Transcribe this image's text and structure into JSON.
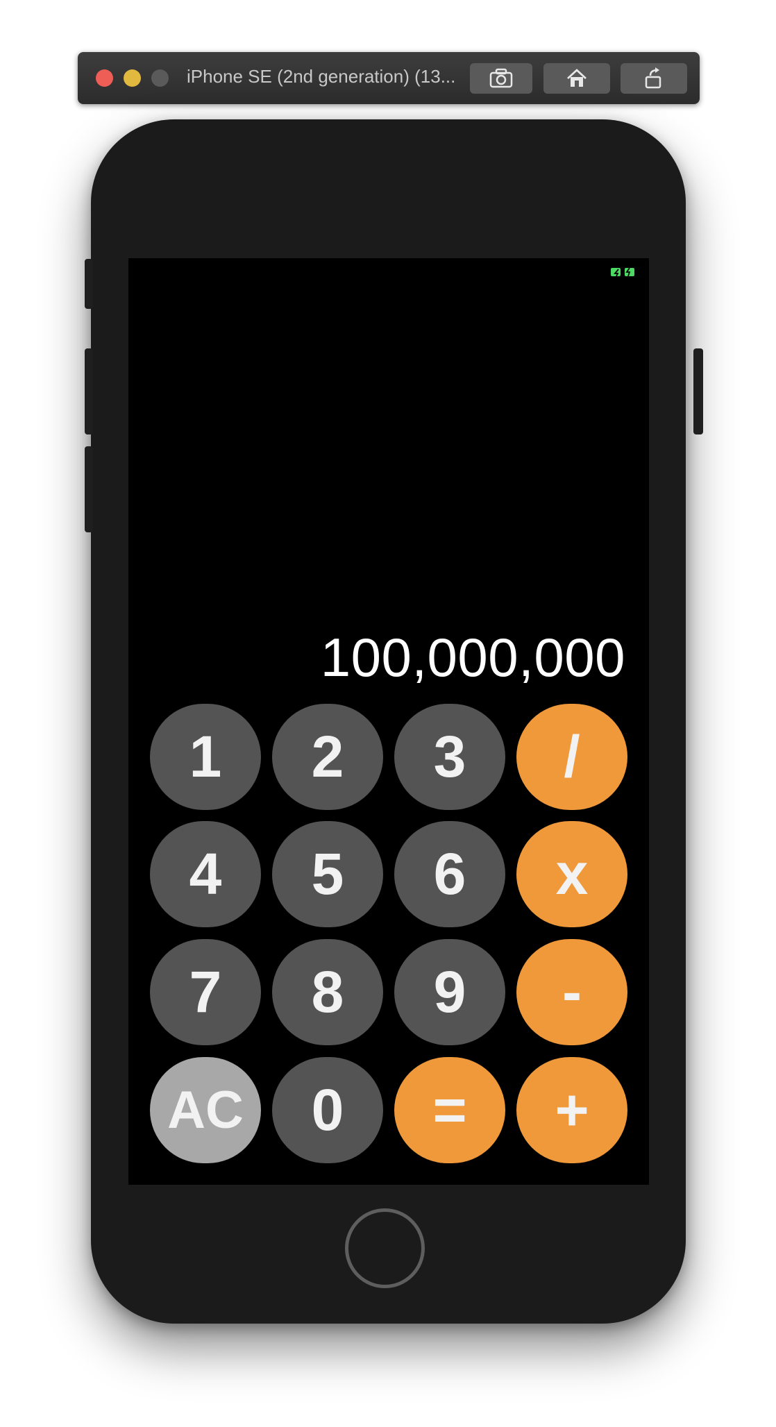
{
  "window": {
    "title": "iPhone SE (2nd generation) (13...",
    "buttons": {
      "screenshot": "camera-icon",
      "home": "house-icon",
      "rotate": "rotate-icon"
    }
  },
  "status_bar": {
    "battery": "battery-icon",
    "battery_color": "#4cd964"
  },
  "calculator": {
    "display_value": "100,000,000",
    "keys": [
      {
        "label": "1",
        "kind": "digit"
      },
      {
        "label": "2",
        "kind": "digit"
      },
      {
        "label": "3",
        "kind": "digit"
      },
      {
        "label": "/",
        "kind": "operator"
      },
      {
        "label": "4",
        "kind": "digit"
      },
      {
        "label": "5",
        "kind": "digit"
      },
      {
        "label": "6",
        "kind": "digit"
      },
      {
        "label": "x",
        "kind": "operator"
      },
      {
        "label": "7",
        "kind": "digit"
      },
      {
        "label": "8",
        "kind": "digit"
      },
      {
        "label": "9",
        "kind": "digit"
      },
      {
        "label": "-",
        "kind": "operator"
      },
      {
        "label": "AC",
        "kind": "function"
      },
      {
        "label": "0",
        "kind": "digit"
      },
      {
        "label": "=",
        "kind": "operator"
      },
      {
        "label": "+",
        "kind": "operator"
      }
    ]
  },
  "colors": {
    "digit_key": "#545454",
    "operator_key": "#f0993a",
    "function_key": "#a8a8a8",
    "screen": "#000000",
    "phone_body": "#1b1b1b"
  }
}
